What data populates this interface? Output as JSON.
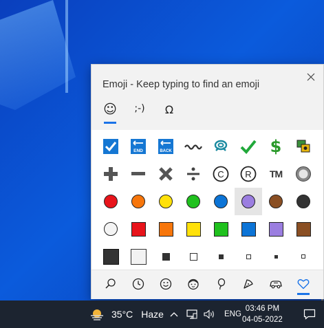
{
  "panel": {
    "title": "Emoji - Keep typing to find an emoji",
    "tabs": [
      {
        "name": "emoji",
        "label": "☺",
        "active": true
      },
      {
        "name": "kaomoji",
        "label": ";-)",
        "active": false
      },
      {
        "name": "symbols",
        "label": "Ω",
        "active": false
      }
    ],
    "grid_rows": [
      [
        "check-box-icon",
        "end-arrow-icon",
        "back-arrow-icon",
        "curly-loop-icon",
        "double-loop-icon",
        "check-mark-icon",
        "dollar-icon",
        "currency-exchange-icon"
      ],
      [
        "plus-icon",
        "minus-icon",
        "multiply-icon",
        "divide-icon",
        "copyright-icon",
        "registered-icon",
        "trademark-icon",
        "radio-button-icon"
      ],
      [
        "red-circle-icon",
        "orange-circle-icon",
        "yellow-circle-icon",
        "green-circle-icon",
        "blue-circle-icon",
        "purple-circle-icon",
        "brown-circle-icon",
        "black-circle-icon"
      ],
      [
        "white-circle-icon",
        "red-square-icon",
        "orange-square-icon",
        "yellow-square-icon",
        "green-square-icon",
        "blue-square-icon",
        "purple-square-icon",
        "brown-square-icon"
      ],
      [
        "black-large-square-icon",
        "white-large-square-icon",
        "black-medium-square-icon",
        "white-medium-square-icon",
        "black-small-square-icon",
        "white-small-square-icon",
        "black-tiny-square-icon",
        "white-tiny-square-icon"
      ]
    ],
    "glyphs": {
      "end": "END",
      "back": "BACK",
      "dollar": "$",
      "tm": "TM",
      "c": "C",
      "r": "R"
    },
    "categories": [
      "search-icon",
      "clock-icon",
      "smiley-icon",
      "people-icon",
      "balloon-icon",
      "pizza-icon",
      "car-icon",
      "heart-icon"
    ],
    "colors": {
      "red": "#e8141b",
      "orange": "#f7760b",
      "yellow": "#ffe10a",
      "green": "#20c11e",
      "blue": "#0c74d6",
      "purple": "#9b7ee0",
      "brown": "#8a4f23",
      "black": "#333333",
      "accent": "#1a73e8"
    }
  },
  "taskbar": {
    "temperature": "35°C",
    "weather": "Haze",
    "language": "ENG",
    "time": "03:46 PM",
    "date": "04-05-2022"
  }
}
